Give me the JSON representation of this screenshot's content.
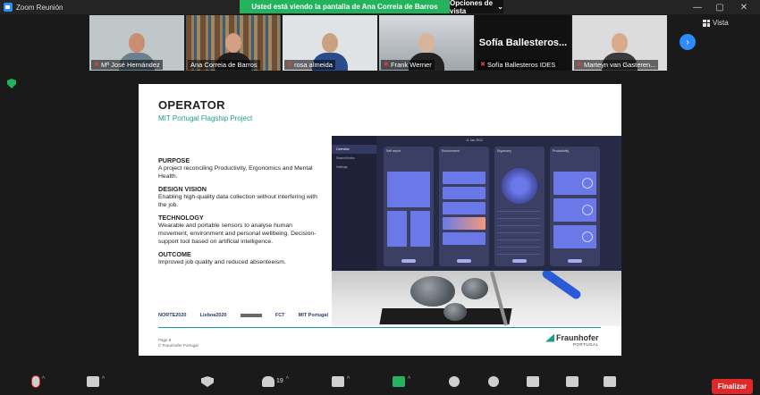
{
  "window": {
    "title": "Zoom Reunión",
    "controls": [
      "minimize",
      "maximize",
      "close"
    ]
  },
  "banner": {
    "text": "Usted está viendo la pantalla de Ana Correia de Barros",
    "options_label": "Opciones de vista"
  },
  "view_button": "Vista",
  "participants": [
    {
      "name": "Mª José Hernández",
      "muted": true,
      "active": false,
      "video": true,
      "bg": "#bfc7c9",
      "head": "#c98e72",
      "shirt": "#6b7f8d"
    },
    {
      "name": "Ana Correia de Barros",
      "muted": false,
      "active": true,
      "video": true,
      "bg": "#8a6a4a",
      "head": "#d3a084",
      "shirt": "#1f1f1f"
    },
    {
      "name": "rosa almeida",
      "muted": true,
      "active": false,
      "video": true,
      "bg": "#dfe3e6",
      "head": "#caa17d",
      "shirt": "#2b4c8a"
    },
    {
      "name": "Frank Werner",
      "muted": true,
      "active": false,
      "video": true,
      "bg": "#b9bec4",
      "head": "#d7b59c",
      "shirt": "#222"
    },
    {
      "name": "Sofía Ballesteros IDES",
      "muted": true,
      "active": false,
      "video": false,
      "display_name": "Sofía Ballesteros..."
    },
    {
      "name": "Marteyn van Gasteren...",
      "muted": true,
      "active": false,
      "video": true,
      "bg": "#dcdcdc",
      "head": "#d9a98a",
      "shirt": "#3a3a3a"
    }
  ],
  "slide": {
    "title": "OPERATOR",
    "subtitle": "MIT Portugal Flagship Project",
    "sections": [
      {
        "heading": "PURPOSE",
        "body": "A project reconciling Productivity, Ergonomics and Mental Health."
      },
      {
        "heading": "DESIGN VISION",
        "body": "Enabling high-quality data collection without interfering with the job."
      },
      {
        "heading": "TECHNOLOGY",
        "body": "Wearable and portable sensors to analyse human movement, environment and personal wellbeing. Decision-support tool based on artificial intelligence."
      },
      {
        "heading": "OUTCOME",
        "body": "Improved job quality and reduced absenteeism."
      }
    ],
    "logos": [
      "NORTE2020",
      "Lisboa2020",
      "FCT",
      "MIT Portugal"
    ],
    "page_label": "Page 8",
    "copyright": "© Fraunhofer Portugal",
    "fraunhofer": "Fraunhofer",
    "fraunhofer_country": "PORTUGAL",
    "dashboard": {
      "date": "11 Jan 2021",
      "nav": [
        "Overview",
        "Search/Index",
        "Settings"
      ],
      "columns": [
        "Self report",
        "Environment",
        "Ergonomy",
        "Productivity"
      ]
    }
  },
  "toolbar": {
    "participants_count": "19",
    "end_label": "Finalizar"
  },
  "colors": {
    "banner": "#23b35c",
    "accent": "#2d8cff",
    "end": "#e02828",
    "slide_accent": "#1f9d8c"
  }
}
